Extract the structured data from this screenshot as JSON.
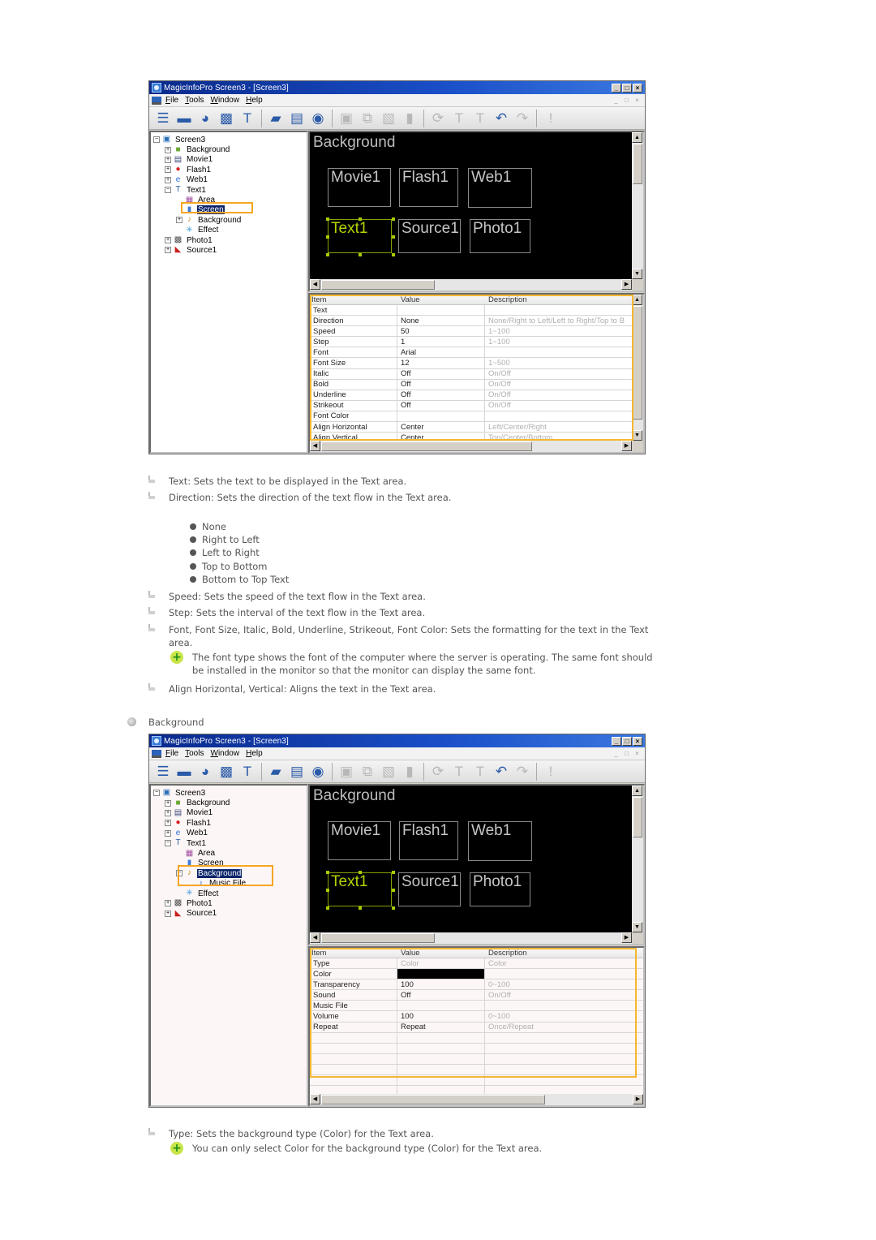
{
  "window": {
    "title": "MagicInfoPro Screen3 - [Screen3]",
    "controls": [
      "_",
      "□",
      "×"
    ],
    "menu": [
      "File",
      "Tools",
      "Window",
      "Help"
    ],
    "mdi_controls": [
      "_",
      "□",
      "×"
    ],
    "toolbar": [
      {
        "icon": "properties-icon",
        "glyph": "☰",
        "enabled": true
      },
      {
        "icon": "monitor-icon",
        "glyph": "▬",
        "enabled": true
      },
      {
        "icon": "timer-icon",
        "glyph": "◕",
        "enabled": true
      },
      {
        "icon": "screen-settings-icon",
        "glyph": "▩",
        "enabled": true
      },
      {
        "icon": "text-icon",
        "glyph": "T",
        "enabled": true
      },
      {
        "sep": true
      },
      {
        "icon": "open-folder-icon",
        "glyph": "▰",
        "enabled": true
      },
      {
        "icon": "save-icon",
        "glyph": "▤",
        "enabled": true
      },
      {
        "icon": "preview-eye-icon",
        "glyph": "◉",
        "enabled": true
      },
      {
        "sep": true
      },
      {
        "icon": "add-screen-icon",
        "glyph": "▣",
        "enabled": false
      },
      {
        "icon": "copy-screen-icon",
        "glyph": "⧉",
        "enabled": false
      },
      {
        "icon": "paste-icon",
        "glyph": "▧",
        "enabled": false
      },
      {
        "icon": "delete-trash-icon",
        "glyph": "▮",
        "enabled": false
      },
      {
        "sep": true
      },
      {
        "icon": "sync-icon",
        "glyph": "⟳",
        "enabled": false
      },
      {
        "icon": "text-send-icon",
        "glyph": "T",
        "enabled": false
      },
      {
        "icon": "text-lock-icon",
        "glyph": "T",
        "enabled": false
      },
      {
        "icon": "undo-icon",
        "glyph": "↶",
        "enabled": true
      },
      {
        "icon": "redo-icon",
        "glyph": "↷",
        "enabled": false
      },
      {
        "sep": true
      },
      {
        "icon": "info-icon",
        "glyph": "!",
        "enabled": false
      }
    ]
  },
  "canvas": {
    "background_label": "Background",
    "zones": [
      "Movie1",
      "Flash1",
      "Web1",
      "Text1",
      "Source1",
      "Photo1"
    ]
  },
  "grid_headers": [
    "Item",
    "Value",
    "Description"
  ],
  "screenshot1": {
    "tree": [
      {
        "label": "Screen3",
        "level": 0,
        "exp": "−",
        "icon": "screen-icon"
      },
      {
        "label": "Background",
        "level": 1,
        "exp": "+",
        "icon": "background-icon"
      },
      {
        "label": "Movie1",
        "level": 1,
        "exp": "+",
        "icon": "movie-icon"
      },
      {
        "label": "Flash1",
        "level": 1,
        "exp": "+",
        "icon": "flash-icon"
      },
      {
        "label": "Web1",
        "level": 1,
        "exp": "+",
        "icon": "web-icon"
      },
      {
        "label": "Text1",
        "level": 1,
        "exp": "−",
        "icon": "text-icon"
      },
      {
        "label": "Area",
        "level": 2,
        "exp": "",
        "icon": "area-icon"
      },
      {
        "label": "Screen",
        "level": 2,
        "exp": "",
        "icon": "screen-layer-icon",
        "selected": true
      },
      {
        "label": "Background",
        "level": 2,
        "exp": "+",
        "icon": "background-sound-icon"
      },
      {
        "label": "Effect",
        "level": 2,
        "exp": "",
        "icon": "effect-icon"
      },
      {
        "label": "Photo1",
        "level": 1,
        "exp": "+",
        "icon": "photo-icon"
      },
      {
        "label": "Source1",
        "level": 1,
        "exp": "+",
        "icon": "source-icon"
      }
    ],
    "rows": [
      [
        "Text",
        "",
        ""
      ],
      [
        "Direction",
        "None",
        "None/Right to Left/Left to Right/Top to B"
      ],
      [
        "Speed",
        "50",
        "1~100"
      ],
      [
        "Step",
        "1",
        "1~100"
      ],
      [
        "Font",
        "Arial",
        ""
      ],
      [
        "Font Size",
        "12",
        "1~500"
      ],
      [
        "Italic",
        "Off",
        "On/Off"
      ],
      [
        "Bold",
        "Off",
        "On/Off"
      ],
      [
        "Underline",
        "Off",
        "On/Off"
      ],
      [
        "Strikeout",
        "Off",
        "On/Off"
      ],
      [
        "Font Color",
        "",
        ""
      ],
      [
        "Align Horizontal",
        "Center",
        "Left/Center/Right"
      ],
      [
        "Align Vertical",
        "Center",
        "Top/Center/Bottom"
      ]
    ]
  },
  "screenshot2": {
    "tree": [
      {
        "label": "Screen3",
        "level": 0,
        "exp": "−",
        "icon": "screen-icon"
      },
      {
        "label": "Background",
        "level": 1,
        "exp": "+",
        "icon": "background-icon"
      },
      {
        "label": "Movie1",
        "level": 1,
        "exp": "+",
        "icon": "movie-icon"
      },
      {
        "label": "Flash1",
        "level": 1,
        "exp": "+",
        "icon": "flash-icon"
      },
      {
        "label": "Web1",
        "level": 1,
        "exp": "+",
        "icon": "web-icon"
      },
      {
        "label": "Text1",
        "level": 1,
        "exp": "−",
        "icon": "text-icon"
      },
      {
        "label": "Area",
        "level": 2,
        "exp": "",
        "icon": "area-icon"
      },
      {
        "label": "Screen",
        "level": 2,
        "exp": "",
        "icon": "screen-layer-icon"
      },
      {
        "label": "Background",
        "level": 2,
        "exp": "−",
        "icon": "background-sound-icon",
        "selected": true
      },
      {
        "label": "Music File",
        "level": 3,
        "exp": "",
        "icon": "music-note-icon"
      },
      {
        "label": "Effect",
        "level": 2,
        "exp": "",
        "icon": "effect-icon"
      },
      {
        "label": "Photo1",
        "level": 1,
        "exp": "+",
        "icon": "photo-icon"
      },
      {
        "label": "Source1",
        "level": 1,
        "exp": "+",
        "icon": "source-icon"
      }
    ],
    "rows": [
      [
        "Type",
        "Color",
        "Color"
      ],
      [
        "Color",
        "",
        ""
      ],
      [
        "Transparency",
        "100",
        "0~100"
      ],
      [
        "Sound",
        "Off",
        "On/Off"
      ],
      [
        "Music File",
        "",
        ""
      ],
      [
        "Volume",
        "100",
        "0~100"
      ],
      [
        "Repeat",
        "Repeat",
        "Once/Repeat"
      ],
      [
        "",
        "",
        ""
      ],
      [
        "",
        "",
        ""
      ],
      [
        "",
        "",
        ""
      ],
      [
        "",
        "",
        ""
      ],
      [
        "",
        "",
        ""
      ],
      [
        "",
        "",
        ""
      ]
    ]
  },
  "doc": {
    "text_item": "Text: Sets the text to be displayed in the Text area.",
    "direction_item": "Direction: Sets the direction of the text flow in the Text area.",
    "direction_options": [
      "None",
      "Right to Left",
      "Left to Right",
      "Top to Bottom",
      "Bottom to Top Text"
    ],
    "speed_item": "Speed: Sets the speed of the text flow in the Text area.",
    "step_item": "Step: Sets the interval of the text flow in the Text area.",
    "font_item_line1": "Font, Font Size, Italic, Bold, Underline, Strikeout, Font Color: Sets the formatting for the text in the Text",
    "font_item_line2": "area.",
    "font_note_line1": "The font type shows the font of the computer where the server is operating. The same font should",
    "font_note_line2": "be installed in the monitor so that the monitor can display the same font.",
    "align_item": "Align Horizontal, Vertical: Aligns the text in the Text area.",
    "section_background": "Background",
    "type_item": "Type: Sets the background type (Color) for the Text area.",
    "type_note": "You can only select Color for the background type (Color) for the Text area."
  },
  "colors": {
    "highlight_orange": "#f5a623",
    "selection_blue": "#0a246a",
    "active_zone_green": "#b6d200"
  }
}
